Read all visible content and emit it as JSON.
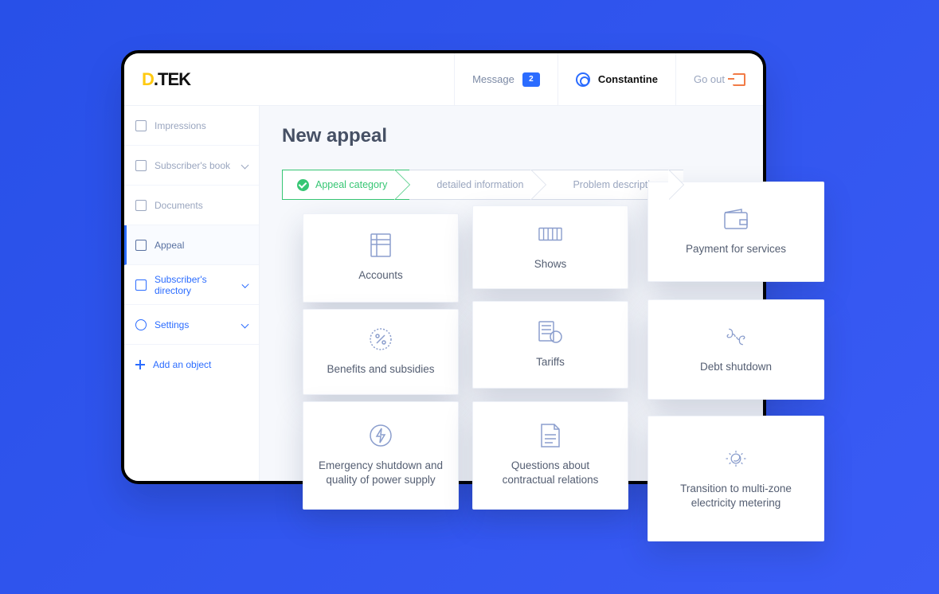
{
  "brand": "D.TEK",
  "header": {
    "message_label": "Message",
    "message_count": "2",
    "user_name": "Constantine",
    "logout_label": "Go out"
  },
  "sidebar": {
    "items": [
      {
        "label": "Impressions",
        "expandable": false
      },
      {
        "label": "Subscriber's book",
        "expandable": true
      },
      {
        "label": "Documents",
        "expandable": false
      },
      {
        "label": "Appeal",
        "expandable": false,
        "active": true
      },
      {
        "label": "Subscriber's directory",
        "expandable": true,
        "blue": true
      },
      {
        "label": "Settings",
        "expandable": true,
        "blue": true
      }
    ],
    "add_label": "Add an object"
  },
  "main": {
    "title": "New appeal",
    "steps": [
      {
        "label": "Appeal category",
        "active": true
      },
      {
        "label": "detailed information"
      },
      {
        "label": "Problem description"
      }
    ]
  },
  "cards": {
    "accounts": "Accounts",
    "shows": "Shows",
    "payment": "Payment for services",
    "benefits": "Benefits and subsidies",
    "tariffs": "Tariffs",
    "debt": "Debt shutdown",
    "emergency": "Emergency shutdown and quality of power supply",
    "contracts": "Questions about contractual relations",
    "metering": "Transition to multi-zone electricity metering"
  }
}
